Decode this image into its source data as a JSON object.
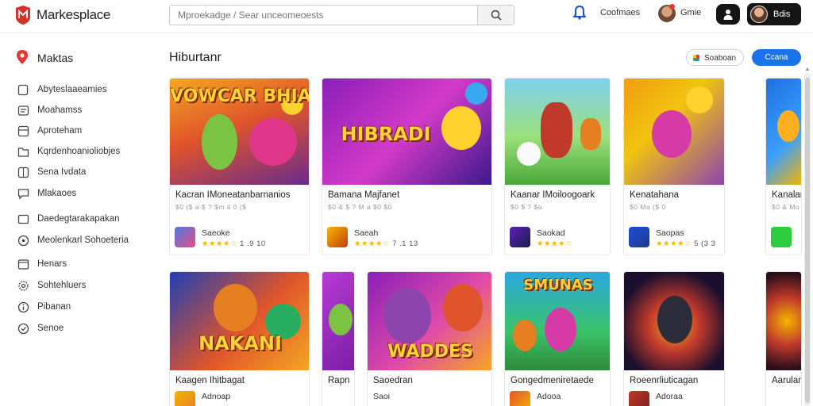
{
  "header": {
    "brand": "Markesplace",
    "search_placeholder": "Mproekadge / Sear unceomeoests",
    "contact_label": "Coofmaes",
    "game_label": "Gmie",
    "user_label": "Bdis"
  },
  "sidebar": {
    "title": "Maktas",
    "items": [
      {
        "label": "Abyteslaaeamies",
        "icon": "square-icon"
      },
      {
        "label": "Moahamss",
        "icon": "dashboard-icon"
      },
      {
        "label": "Aproteham",
        "icon": "layout-icon"
      },
      {
        "label": "Kqrdenhoanioliobjes",
        "icon": "folder-icon"
      },
      {
        "label": "Sena Ivdata",
        "icon": "grid-icon"
      },
      {
        "label": "Mlakaoes",
        "icon": "chat-icon"
      },
      {
        "label": "Daedegtarakapakan",
        "icon": "rect-icon"
      },
      {
        "label": "Meolenkarl Sohoeteria",
        "icon": "circle-icon"
      },
      {
        "label": "Henars",
        "icon": "box-icon"
      },
      {
        "label": "Sohtehluers",
        "icon": "gear-icon"
      },
      {
        "label": "Pibanan",
        "icon": "info-icon"
      },
      {
        "label": "Senoe",
        "icon": "settings-icon"
      }
    ]
  },
  "main": {
    "title": "Hiburtanr",
    "filter_label": "Soaboan",
    "action_label": "Ccana",
    "row1": [
      {
        "title": "Kacran IMoneatanbarnanios",
        "meta": "$0 ($ a $ ?  $m 4    0 ($",
        "publisher": "Saeoke",
        "rating": "1 .9 10",
        "art_text": "VOWCAR BHIALIE"
      },
      {
        "title": "Bamana Majfanet",
        "meta": "$0 & $ ?  M  a   $0 $0",
        "publisher": "Saeah",
        "rating": "7 .1 13",
        "art_text": "HIBRADI"
      },
      {
        "title": "Kaanar IMoiloogoark",
        "meta": "$0 $ ?    $a",
        "publisher": "Saokad",
        "rating": "",
        "art_text": ""
      },
      {
        "title": "Kenatahana",
        "meta": "$0 Ma ($ 0",
        "publisher": "Saopas",
        "rating": "5 (3 3",
        "art_text": ""
      },
      {
        "title": "Kanalan",
        "meta": "$0 & Mo",
        "publisher": "",
        "rating": "",
        "art_text": ""
      }
    ],
    "row2": [
      {
        "title": "Kaagen Ihitbagat",
        "meta": "",
        "publisher": "Adnoap",
        "rating": "",
        "art_text": "NAKANI"
      },
      {
        "title": "Rapn",
        "meta": "",
        "publisher": "",
        "rating": "",
        "art_text": ""
      },
      {
        "title": "Saoedran",
        "meta": "",
        "publisher": "Saoi",
        "rating": "",
        "art_text": "WADDES"
      },
      {
        "title": "Gongedmeniretaede",
        "meta": "",
        "publisher": "Adooa",
        "rating": "",
        "art_text": "SMUNAS"
      },
      {
        "title": "Roeenrliuticagan",
        "meta": "",
        "publisher": "Adoraa",
        "rating": "",
        "art_text": ""
      },
      {
        "title": "Aarulann",
        "meta": "",
        "publisher": "",
        "rating": "",
        "art_text": ""
      }
    ]
  },
  "colors": {
    "accent": "#1a73e8",
    "brand_red": "#d93025",
    "star": "#f4b400"
  }
}
